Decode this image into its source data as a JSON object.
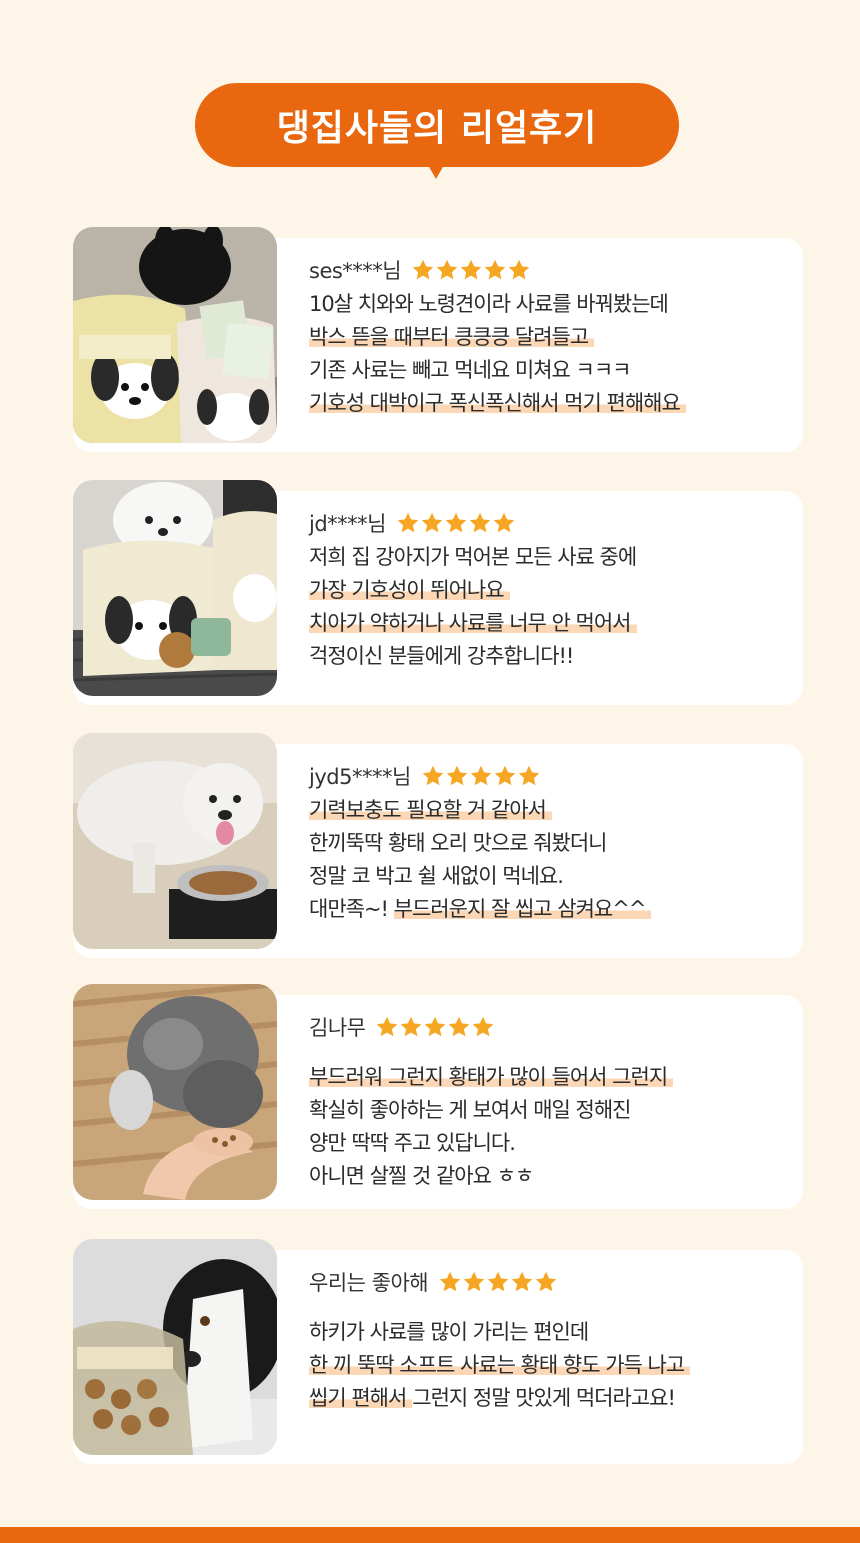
{
  "header": {
    "title": "댕집사들의 리얼후기"
  },
  "colors": {
    "accent": "#e8670f",
    "background": "#fdf6e8",
    "star": "#f5a623",
    "highlight": "#fbd7b6"
  },
  "rating_max": 5,
  "reviews": [
    {
      "reviewer": "ses****님",
      "rating": 5,
      "lines": [
        "10살 치와와 노령견이라 사료를 바꿔봤는데",
        "박스 뜯을 때부터 킁킁킁 달려들고",
        "기존 사료는 빼고 먹네요 미쳐요 ㅋㅋㅋ",
        "기호성 대박이구 폭신폭신해서 먹기 편해해요"
      ]
    },
    {
      "reviewer": "jd****님",
      "rating": 5,
      "lines": [
        "저희 집 강아지가 먹어본 모든 사료 중에",
        "가장 기호성이 뛰어나요",
        "치아가 약하거나 사료를 너무 안 먹어서",
        "걱정이신 분들에게 강추합니다!!"
      ]
    },
    {
      "reviewer": "jyd5****님",
      "rating": 5,
      "lines": [
        "기력보충도 필요할 거 같아서",
        "한끼뚝딱 황태 오리 맛으로 줘봤더니",
        "정말 코 박고 쉴 새없이 먹네요.",
        "대만족~!",
        "부드러운지 잘 씹고 삼켜요^^"
      ]
    },
    {
      "reviewer": "김나무",
      "rating": 5,
      "lines": [
        "부드러워 그런지 황태가 많이 들어서 그런지",
        "확실히 좋아하는 게 보여서 매일 정해진",
        "양만 딱딱 주고 있답니다.",
        "아니면 살찔 것 같아요 ㅎㅎ"
      ]
    },
    {
      "reviewer": "우리는 좋아해",
      "rating": 5,
      "lines": [
        "하키가 사료를 많이 가리는 편인데",
        "한 끼 뚝딱 소프트 사료는 황태 향도 가득 나고",
        "씹기 편해서",
        "그런지 정말 맛있게 먹더라고요!"
      ]
    }
  ]
}
